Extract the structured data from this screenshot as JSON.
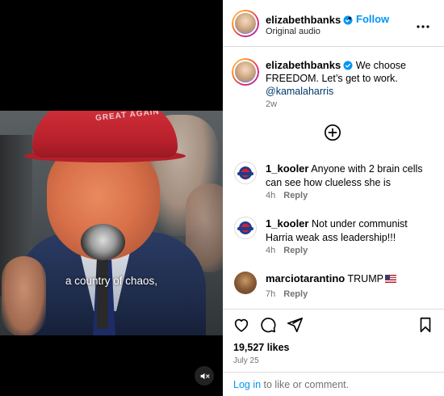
{
  "post": {
    "video": {
      "caption_text": "a country of chaos,",
      "hat_text": "GREAT AGAIN",
      "mute_icon": "muted-speaker-icon"
    },
    "header": {
      "username": "elizabethbanks",
      "separator": "•",
      "follow_label": "Follow",
      "subtitle": "Original audio",
      "more_icon": "more-options-icon"
    },
    "caption": {
      "username": "elizabethbanks",
      "text": "We choose FREEDOM. Let’s get to work.",
      "mention": "@kamalaharris",
      "time": "2w"
    },
    "comments": [
      {
        "username": "1_kooler",
        "text": "Anyone with 2 brain cells can see how clueless she is",
        "time": "4h",
        "reply_label": "Reply"
      },
      {
        "username": "1_kooler",
        "text": "Not under communist Harria weak ass leadership!!!",
        "time": "4h",
        "reply_label": "Reply"
      },
      {
        "username": "marciotarantino",
        "text": "TRUMP",
        "emoji": "us-flag",
        "time": "7h",
        "reply_label": "Reply"
      }
    ],
    "likes": "19,527 likes",
    "date": "July 25",
    "login": {
      "link": "Log in",
      "rest": " to like or comment."
    }
  },
  "colors": {
    "accent": "#0095f6",
    "mention": "#00376b",
    "muted_text": "#737373",
    "verified_badge": "#0095f6",
    "border": "#dbdbdb"
  }
}
